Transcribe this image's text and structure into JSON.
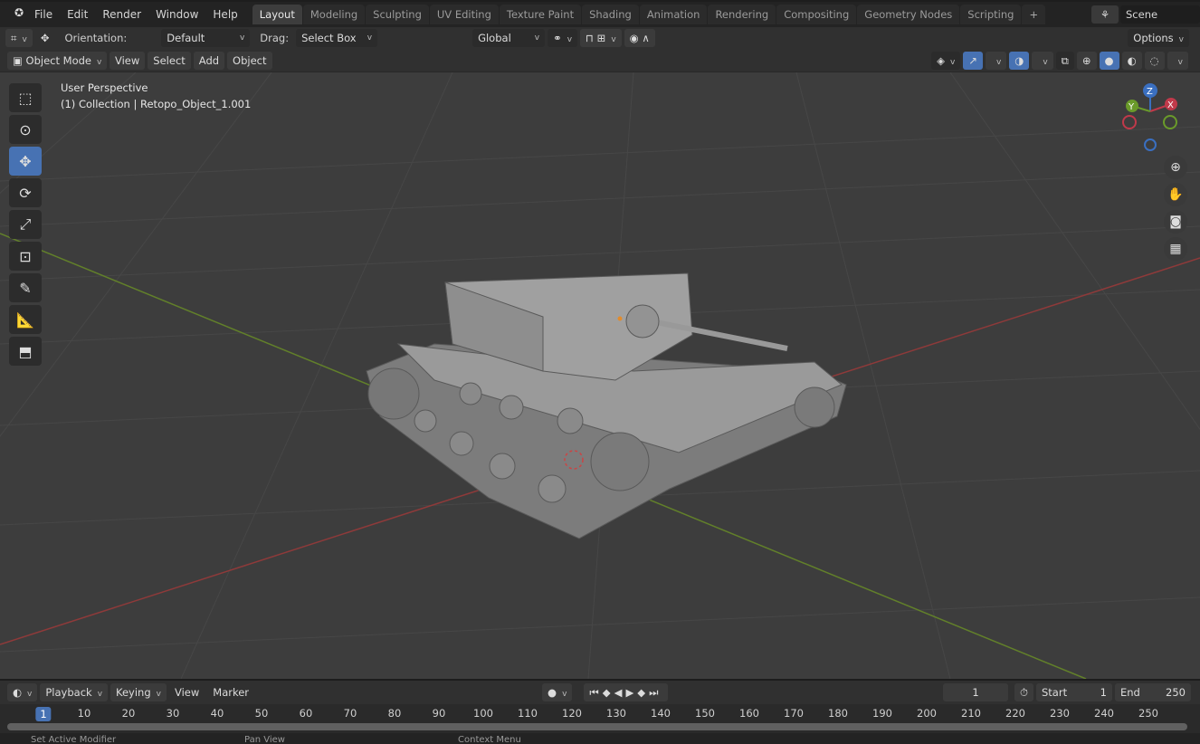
{
  "menu": [
    "File",
    "Edit",
    "Render",
    "Window",
    "Help"
  ],
  "workspaces": [
    "Layout",
    "Modeling",
    "Sculpting",
    "UV Editing",
    "Texture Paint",
    "Shading",
    "Animation",
    "Rendering",
    "Compositing",
    "Geometry Nodes",
    "Scripting"
  ],
  "add_tab": "+",
  "scene": "Scene",
  "tool_header": {
    "orientation_label": "Orientation:",
    "orientation_value": "Default",
    "drag_label": "Drag:",
    "drag_value": "Select Box",
    "transform_orientation": "Global",
    "options": "Options"
  },
  "viewport_header": {
    "mode": "Object Mode",
    "menus": [
      "View",
      "Select",
      "Add",
      "Object"
    ]
  },
  "overlay": {
    "view_name": "User Perspective",
    "collection": "(1) Collection | Retopo_Object_1.001"
  },
  "gizmo": {
    "x": "X",
    "y": "Y",
    "z": "Z"
  },
  "timeline_header": {
    "menus": [
      "Playback",
      "Keying",
      "View",
      "Marker"
    ],
    "current_frame": "1",
    "start_label": "Start",
    "start": "1",
    "end_label": "End",
    "end": "250"
  },
  "timeline_ticks": [
    "1",
    "10",
    "20",
    "30",
    "40",
    "50",
    "60",
    "70",
    "80",
    "90",
    "100",
    "110",
    "120",
    "130",
    "140",
    "150",
    "160",
    "170",
    "180",
    "190",
    "200",
    "210",
    "220",
    "230",
    "240",
    "250"
  ],
  "status": [
    "Set Active Modifier",
    "Pan View",
    "Context Menu"
  ],
  "colors": {
    "accent": "#4772b3",
    "x_axis": "#9a3a3a",
    "y_axis": "#6a8a2a"
  }
}
